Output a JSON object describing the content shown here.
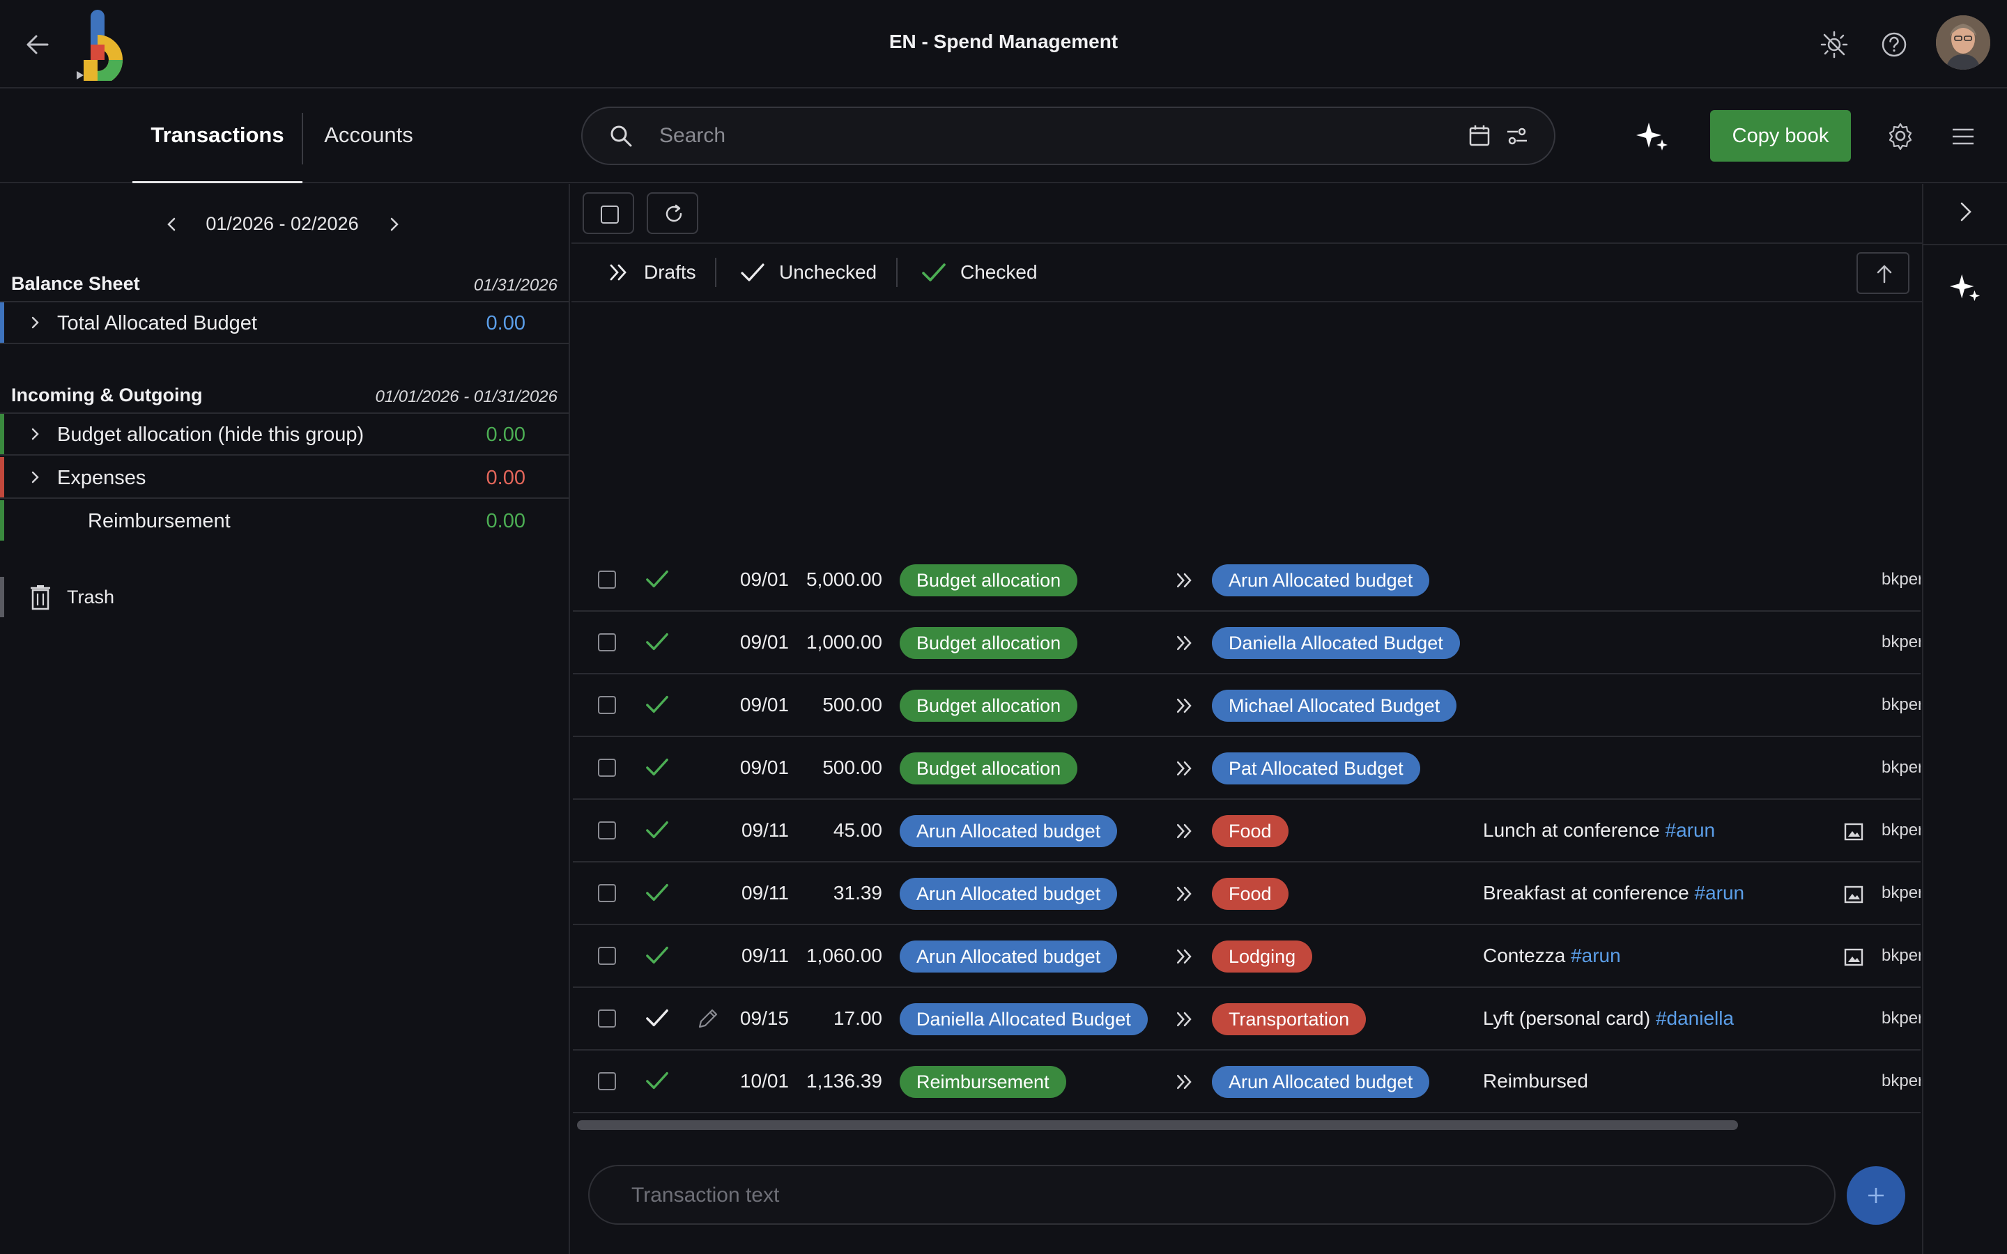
{
  "header": {
    "title": "EN - Spend Management"
  },
  "tabs": [
    {
      "label": "Transactions",
      "active": true
    },
    {
      "label": "Accounts",
      "active": false
    }
  ],
  "search": {
    "placeholder": "Search"
  },
  "toolbar": {
    "copy_book_label": "Copy book"
  },
  "period": {
    "label": "01/2026 - 02/2026"
  },
  "balance_sheet": {
    "title": "Balance Sheet",
    "date": "01/31/2026",
    "groups": [
      {
        "label": "Total Allocated Budget",
        "value": "0.00",
        "color": "#5b9ee8",
        "bar": "#3e73bd"
      }
    ]
  },
  "incoming_outgoing": {
    "title": "Incoming & Outgoing",
    "date": "01/01/2026 - 01/31/2026",
    "groups": [
      {
        "label": "Budget allocation (hide this group)",
        "value": "0.00",
        "color": "#4cae54",
        "bar": "#3a8a3e"
      },
      {
        "label": "Expenses",
        "value": "0.00",
        "color": "#e2665a",
        "bar": "#c2483c"
      },
      {
        "label": "Reimbursement",
        "value": "0.00",
        "color": "#4cae54",
        "bar": "#3a8a3e"
      }
    ]
  },
  "trash": {
    "label": "Trash"
  },
  "filters": {
    "drafts": "Drafts",
    "unchecked": "Unchecked",
    "checked": "Checked"
  },
  "transactions": [
    {
      "checked": true,
      "date": "09/01",
      "amount": "5,000.00",
      "from": "Budget allocation",
      "from_color": "green",
      "to": "Arun Allocated budget",
      "to_color": "blue",
      "desc": "",
      "tag": "",
      "attachment": false,
      "id": "bkper"
    },
    {
      "checked": true,
      "date": "09/01",
      "amount": "1,000.00",
      "from": "Budget allocation",
      "from_color": "green",
      "to": "Daniella Allocated Budget",
      "to_color": "blue",
      "desc": "",
      "tag": "",
      "attachment": false,
      "id": "bkper"
    },
    {
      "checked": true,
      "date": "09/01",
      "amount": "500.00",
      "from": "Budget allocation",
      "from_color": "green",
      "to": "Michael Allocated Budget",
      "to_color": "blue",
      "desc": "",
      "tag": "",
      "attachment": false,
      "id": "bkper"
    },
    {
      "checked": true,
      "date": "09/01",
      "amount": "500.00",
      "from": "Budget allocation",
      "from_color": "green",
      "to": "Pat Allocated Budget",
      "to_color": "blue",
      "desc": "",
      "tag": "",
      "attachment": false,
      "id": "bkper"
    },
    {
      "checked": true,
      "date": "09/11",
      "amount": "45.00",
      "from": "Arun Allocated budget",
      "from_color": "blue",
      "to": "Food",
      "to_color": "red",
      "desc": "Lunch at conference ",
      "tag": "#arun",
      "attachment": true,
      "id": "bkper"
    },
    {
      "checked": true,
      "date": "09/11",
      "amount": "31.39",
      "from": "Arun Allocated budget",
      "from_color": "blue",
      "to": "Food",
      "to_color": "red",
      "desc": "Breakfast at conference ",
      "tag": "#arun",
      "attachment": true,
      "id": "bkper"
    },
    {
      "checked": true,
      "date": "09/11",
      "amount": "1,060.00",
      "from": "Arun Allocated budget",
      "from_color": "blue",
      "to": "Lodging",
      "to_color": "red",
      "desc": "Contezza ",
      "tag": "#arun",
      "attachment": true,
      "id": "bkper"
    },
    {
      "checked": false,
      "editable": true,
      "date": "09/15",
      "amount": "17.00",
      "from": "Daniella Allocated Budget",
      "from_color": "blue",
      "to": "Transportation",
      "to_color": "red",
      "desc": "Lyft (personal card) ",
      "tag": "#daniella",
      "attachment": false,
      "id": "bkper"
    },
    {
      "checked": true,
      "date": "10/01",
      "amount": "1,136.39",
      "from": "Reimbursement",
      "from_color": "green",
      "to": "Arun Allocated budget",
      "to_color": "blue",
      "desc": "Reimbursed",
      "tag": "",
      "attachment": false,
      "id": "bkper"
    }
  ],
  "composer": {
    "placeholder": "Transaction text"
  },
  "icons": {
    "back": "arrow-left-icon",
    "theme": "brightness-icon",
    "help": "help-circle-icon",
    "search": "search-icon",
    "calendar": "calendar-icon",
    "filter": "sliders-icon",
    "ai": "sparkle-icon",
    "settings": "gear-icon",
    "menu": "hamburger-icon"
  }
}
